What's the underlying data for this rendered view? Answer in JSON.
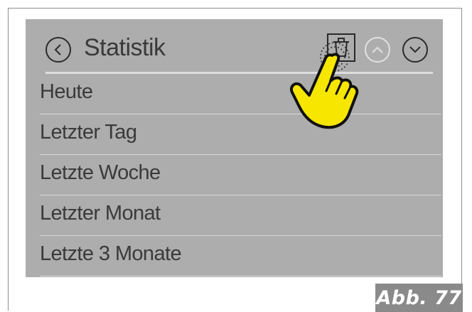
{
  "header": {
    "title": "Statistik",
    "back_icon": "chevron-left-icon",
    "delete_icon": "trash-icon",
    "up_icon": "chevron-up-icon",
    "down_icon": "chevron-down-icon"
  },
  "menu": {
    "items": [
      {
        "label": "Heute"
      },
      {
        "label": "Letzter Tag"
      },
      {
        "label": "Letzte Woche"
      },
      {
        "label": "Letzter Monat"
      },
      {
        "label": "Letzte 3 Monate"
      }
    ]
  },
  "figure_label": "Abb. 77",
  "colors": {
    "screen_background": "#adadad",
    "divider": "#d8d8d8",
    "text": "#3a3a3a",
    "hand_fill": "#f6e600",
    "badge_background": "#8a8a8a",
    "disabled_button": "#e1e1e1"
  }
}
